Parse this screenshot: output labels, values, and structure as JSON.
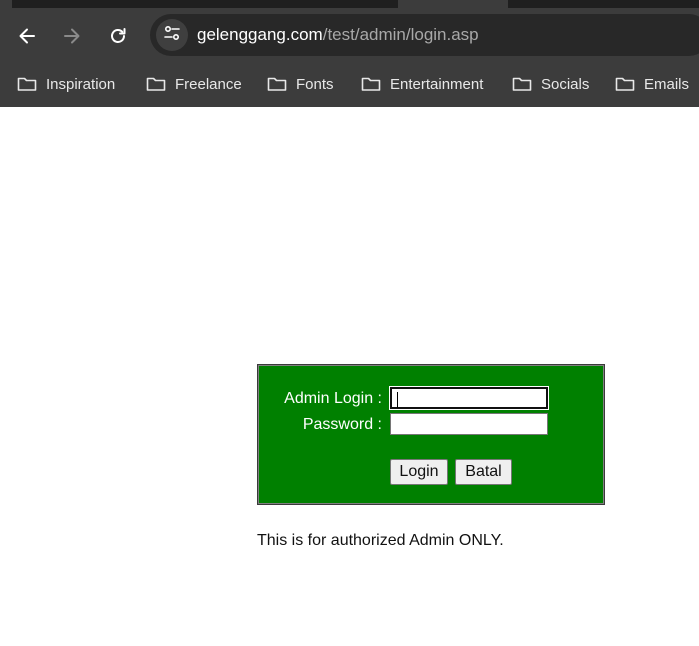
{
  "browser": {
    "url_host": "gelenggang.com",
    "url_path": "/test/admin/login.asp",
    "bookmarks": [
      {
        "label": "Inspiration"
      },
      {
        "label": "Freelance"
      },
      {
        "label": "Fonts"
      },
      {
        "label": "Entertainment"
      },
      {
        "label": "Socials"
      },
      {
        "label": "Emails"
      }
    ]
  },
  "login_form": {
    "username_label": "Admin Login :",
    "password_label": "Password :",
    "username_value": "",
    "password_value": "",
    "login_button": "Login",
    "cancel_button": "Batal",
    "background_color": "#008000"
  },
  "notice": "This is for authorized Admin ONLY."
}
